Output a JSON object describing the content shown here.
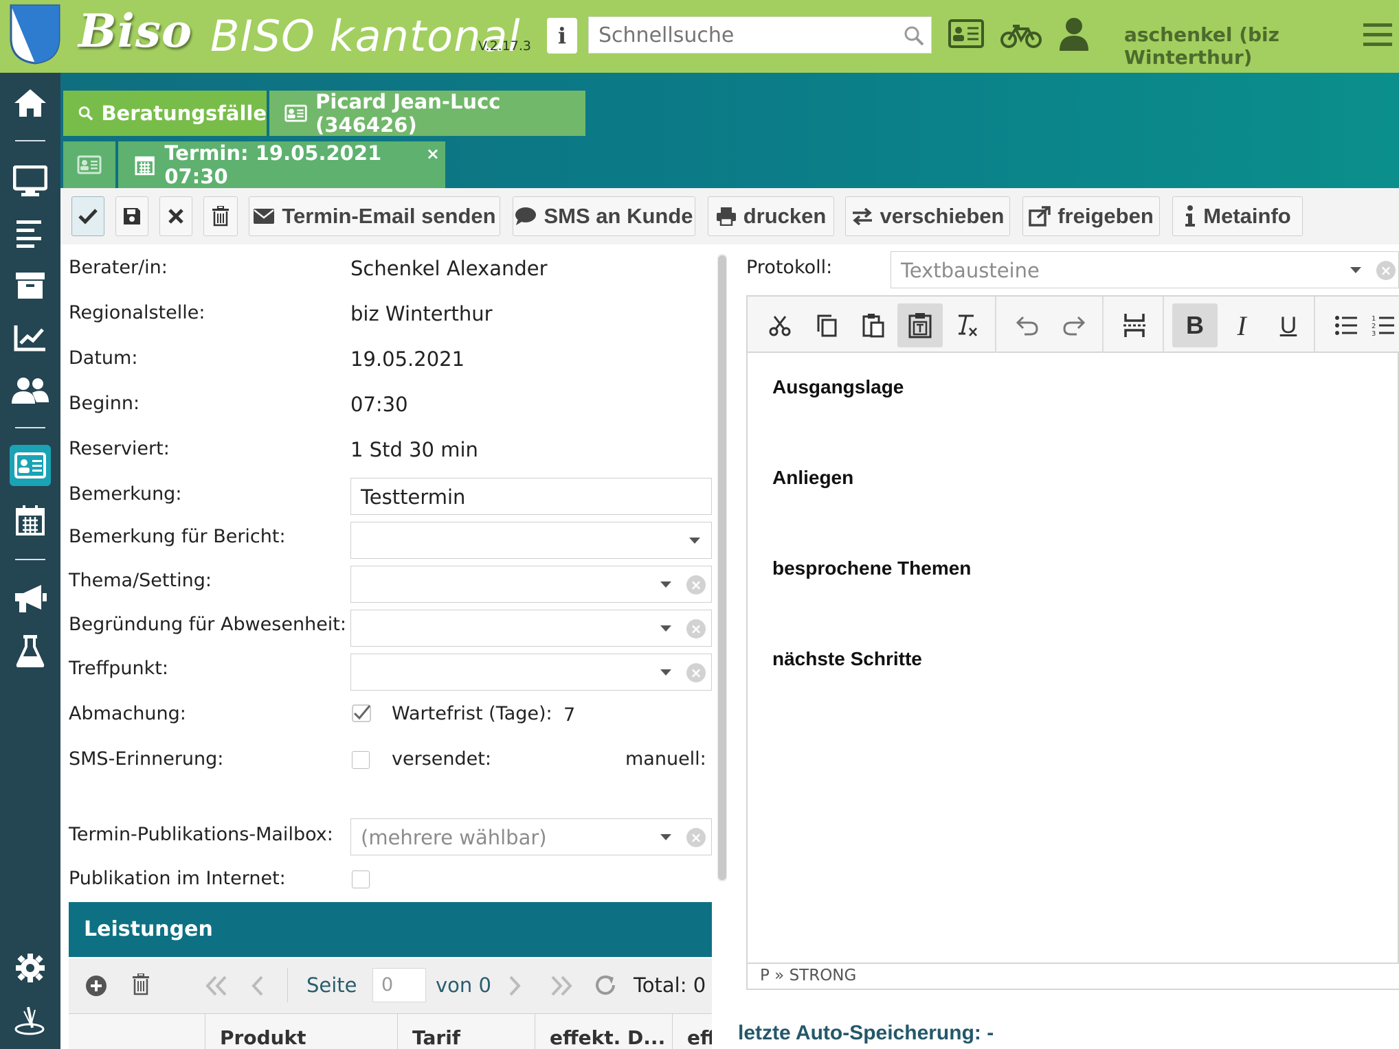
{
  "header": {
    "logo_text": "Biso",
    "app_title": "BISO kantonal",
    "version": "V.2.17.3",
    "info_label": "i",
    "search_placeholder": "Schnellsuche",
    "user": "aschenkel (biz Winterthur)"
  },
  "sidebar": {
    "items": [
      "home-icon",
      "desktop-icon",
      "list-icon",
      "archive-icon",
      "chart-icon",
      "users-icon",
      "id-card-icon",
      "calendar-icon",
      "megaphone-icon",
      "flask-icon",
      "gear-icon",
      "logo-icon"
    ]
  },
  "tabs": {
    "beratung": "Beratungsfälle",
    "person": "Picard Jean-Lucc (346426)",
    "termin": "Termin: 19.05.2021 07:30",
    "close": "×"
  },
  "toolbar": {
    "email": "Termin-Email senden",
    "sms": "SMS an Kunde",
    "print": "drucken",
    "move": "verschieben",
    "release": "freigeben",
    "meta": "Metainfo"
  },
  "form": {
    "berater_label": "Berater/in:",
    "berater_value": "Schenkel Alexander",
    "regional_label": "Regionalstelle:",
    "regional_value": "biz Winterthur",
    "datum_label": "Datum:",
    "datum_value": "19.05.2021",
    "beginn_label": "Beginn:",
    "beginn_value": "07:30",
    "reserviert_label": "Reserviert:",
    "reserviert_value": "1 Std 30 min",
    "bemerkung_label": "Bemerkung:",
    "bemerkung_value": "Testtermin",
    "bericht_label": "Bemerkung für Bericht:",
    "thema_label": "Thema/Setting:",
    "abwesenheit_label": "Begründung für Abwesenheit:",
    "treffpunkt_label": "Treffpunkt:",
    "abmachung_label": "Abmachung:",
    "wartefrist_label": "Wartefrist (Tage):",
    "wartefrist_value": "7",
    "sms_label": "SMS-Erinnerung:",
    "versendet_label": "versendet:",
    "manuell_label": "manuell:",
    "mailbox_label": "Termin-Publikations-Mailbox:",
    "mailbox_placeholder": "(mehrere wählbar)",
    "publikation_label": "Publikation im Internet:"
  },
  "leistungen": {
    "title": "Leistungen",
    "seite_label": "Seite",
    "page_value": "0",
    "von_label": "von 0",
    "total_label": "Total: 0",
    "columns": [
      "Produkt",
      "Tarif",
      "effekt. D...",
      "eff"
    ]
  },
  "protokoll": {
    "label": "Protokoll:",
    "textbausteine_placeholder": "Textbausteine",
    "headings": [
      "Ausgangslage",
      "Anliegen",
      "besprochene Themen",
      "nächste Schritte"
    ],
    "status_path": "P » STRONG",
    "bold_label": "B",
    "italic_label": "I",
    "underline_label": "U"
  },
  "autosave": "letzte Auto-Speicherung: -"
}
